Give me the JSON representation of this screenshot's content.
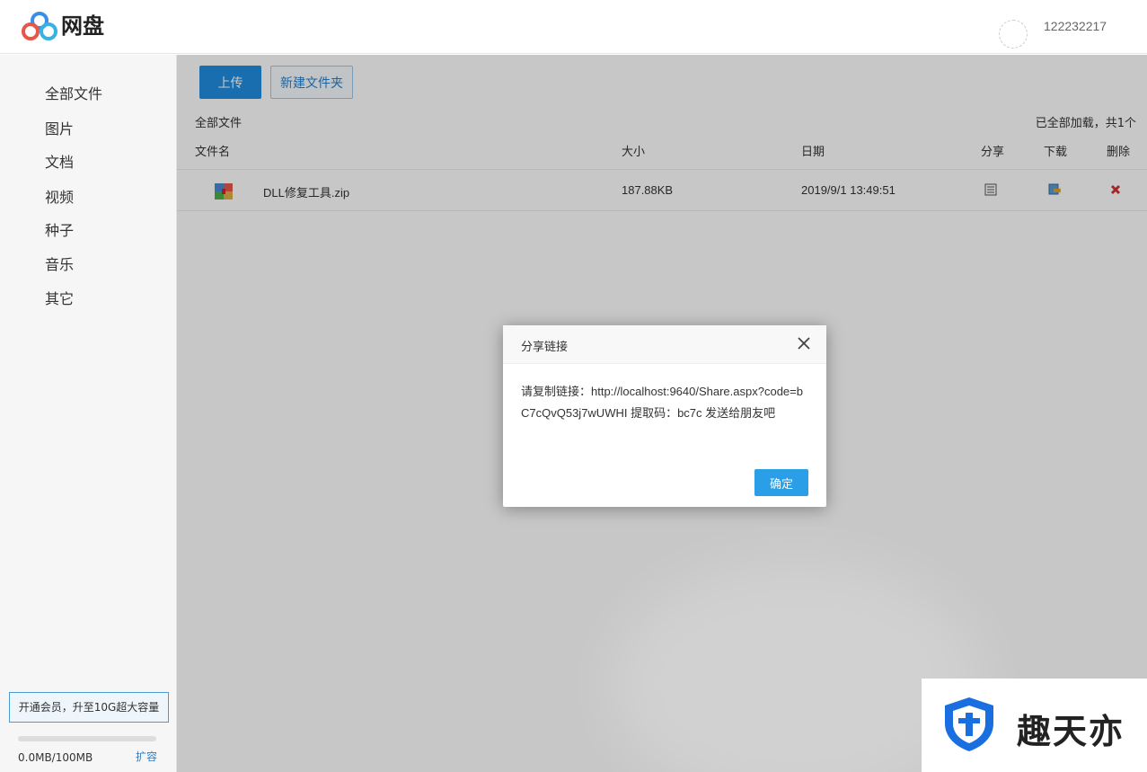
{
  "header": {
    "logo_text": "网盘",
    "username": "122232217"
  },
  "sidebar": {
    "items": [
      "全部文件",
      "图片",
      "文档",
      "视频",
      "种子",
      "音乐",
      "其它"
    ],
    "vip_banner": "开通会员，升至10G超大容量",
    "quota_text": "0.0MB/100MB",
    "quota_fraction": 0.0,
    "expand_label": "扩容"
  },
  "toolbar": {
    "upload_label": "上传",
    "new_folder_label": "新建文件夹"
  },
  "breadcrumb": "全部文件",
  "loaded_status": "已全部加载，共1个",
  "table": {
    "headers": {
      "name": "文件名",
      "size": "大小",
      "date": "日期",
      "share": "分享",
      "download": "下载",
      "delete": "删除"
    },
    "rows": [
      {
        "icon": "zip-file-icon",
        "name": "DLL修复工具.zip",
        "size": "187.88KB",
        "date": "2019/9/1 13:49:51"
      }
    ]
  },
  "modal": {
    "title": "分享链接",
    "body": "请复制链接：http://localhost:9640/Share.aspx?code=bC7cQvQ53j7wUWHI 提取码：bc7c 发送给朋友吧",
    "ok_label": "确定"
  },
  "watermark": {
    "text": "趣天亦"
  },
  "colors": {
    "accent": "#1f8ee0",
    "delete": "#d33333"
  }
}
